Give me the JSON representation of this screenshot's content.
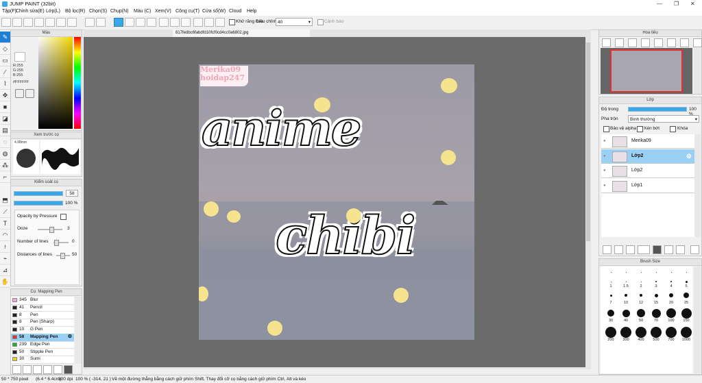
{
  "app": {
    "title": "JUMP PAINT (32bit)",
    "menu": [
      "Tập(F)",
      "Chỉnh sửa(E)",
      "Lớp(L)",
      "Bộ lọc(R)",
      "Chọn(S)",
      "Chụp(N)",
      "Màu (C)",
      "Xem(V)",
      "Công cụ(T)",
      "Cửa sổ(W)",
      "Cloud",
      "Help"
    ]
  },
  "toolbar": {
    "antialias_label": "Khử răng cưa",
    "adjust_label": "Điều chỉnh",
    "adjust_value": "40",
    "warning_label": "Cảnh báo"
  },
  "document": {
    "tab_title": "817fedbc6fabdfd10fcf0cd4cc0a6802.jpg"
  },
  "artwork": {
    "watermark_1": "Merika09",
    "watermark_2": "hoidap247",
    "text_1": "anime",
    "text_2": "chibi"
  },
  "color_panel": {
    "title": "Màu",
    "r": "R:255",
    "g": "G:255",
    "b": "B:255",
    "hex": "#FFFFFF"
  },
  "preview_panel": {
    "title": "Xem trước cọ",
    "size": "4.98mm"
  },
  "brush_control": {
    "title": "Kiểm soát cọ",
    "size_value": "58",
    "opacity_value": "100 %",
    "opacity_pressure_label": "Opacity by Pressure",
    "ooze_label": "Ooze",
    "ooze_value": "3",
    "lines_label": "Number of lines",
    "lines_value": "0",
    "distance_label": "Distances of lines",
    "distance_value": "50"
  },
  "brush_list": {
    "title": "Cọ: Mapping Pen",
    "items": [
      {
        "size": "345",
        "name": "Blur",
        "color": "#f0a8d8"
      },
      {
        "size": "41",
        "name": "Pencil",
        "color": "#222222"
      },
      {
        "size": "8",
        "name": "Pen",
        "color": "#222222"
      },
      {
        "size": "8",
        "name": "Pen (Sharp)",
        "color": "#222222"
      },
      {
        "size": "10",
        "name": "G Pen",
        "color": "#222222"
      },
      {
        "size": "58",
        "name": "Mapping Pen",
        "color": "#e03030"
      },
      {
        "size": "239",
        "name": "Edge Pen",
        "color": "#20b030"
      },
      {
        "size": "50",
        "name": "Stipple Pen",
        "color": "#222222"
      },
      {
        "size": "30",
        "name": "Sumi",
        "color": "#e8d020"
      }
    ]
  },
  "navigator": {
    "title": "Hoa tiêu"
  },
  "layers_panel": {
    "title": "Lớp",
    "opacity_label": "Độ trong",
    "opacity_value": "100 %",
    "blend_label": "Pha trộn",
    "blend_value": "Bình thường",
    "protect_alpha": "Bảo vệ alpha",
    "clipping": "Xén bớt",
    "lock": "Khóa",
    "layers": [
      {
        "name": "Merika09",
        "selected": false
      },
      {
        "name": "Lớp2",
        "selected": true
      },
      {
        "name": "Lớp2",
        "selected": false
      },
      {
        "name": "Lớp1",
        "selected": false
      }
    ]
  },
  "brush_size": {
    "title": "Brush Size",
    "rows": [
      [
        "1",
        "1.5",
        "2",
        "3",
        "4",
        "5"
      ],
      [
        "7",
        "10",
        "12",
        "15",
        "20",
        "25"
      ],
      [
        "30",
        "40",
        "50",
        "70",
        "100",
        "150"
      ],
      [
        "200",
        "300",
        "400",
        "500",
        "700",
        "1000"
      ]
    ],
    "row0_label": [
      "",
      "",
      "",
      "",
      "",
      ""
    ]
  },
  "status": {
    "size": "50 * 750 pixel",
    "physical": "(6.4 * 6.4cm)",
    "dpi": "300 dpi",
    "zoom": "100 %",
    "coords": "( -314, 21 )",
    "hint": "Vẽ một đường thẳng bằng cách giữ phím Shift, Thay đổi cỡ cọ bằng cách giữ phím Ctrl, Alt và kéo"
  }
}
